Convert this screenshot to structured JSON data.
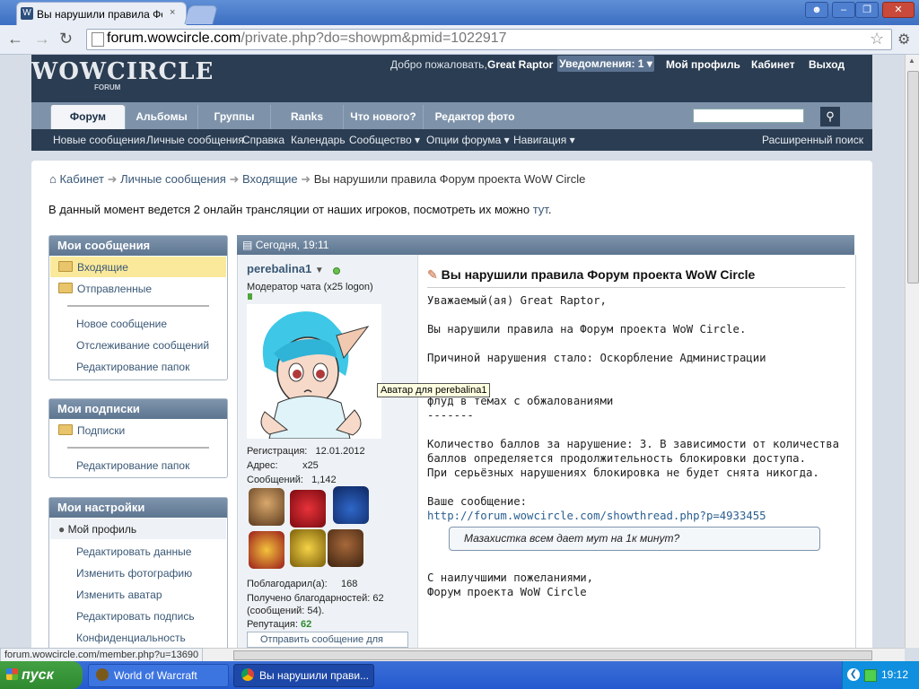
{
  "browser": {
    "tab_title": "Вы нарушили правила Фору",
    "tab_close": "×",
    "url_domain": "forum.wowcircle.com",
    "url_path": "/private.php?do=showpm&pmid=1022917",
    "status_url": "forum.wowcircle.com/member.php?u=13690"
  },
  "header": {
    "logo": "WOWCIRCLE",
    "logo_sub": "FORUM",
    "welcome": "Добро пожаловать,",
    "username": "Great Raptor",
    "notifications": "Уведомления: 1",
    "profile": "Мой профиль",
    "cabinet": "Кабинет",
    "exit": "Выход"
  },
  "nav": {
    "tabs": [
      "Форум",
      "Альбомы",
      "Группы",
      "Ranks",
      "Что нового?",
      "Редактор фото"
    ],
    "sublinks": [
      "Новые сообщения",
      "Личные сообщения",
      "Справка",
      "Календарь",
      "Сообщество",
      "Опции форума",
      "Навигация"
    ],
    "advanced_search": "Расширенный поиск"
  },
  "breadcrumbs": [
    "Кабинет",
    "Личные сообщения",
    "Входящие",
    "Вы нарушили правила Форум проекта WoW Circle"
  ],
  "notice": {
    "text": "В данный момент ведется 2 онлайн трансляции от наших игроков, посмотреть их можно ",
    "link": "тут",
    "end": "."
  },
  "sidebar": {
    "my_messages": {
      "title": "Мои сообщения",
      "inbox": "Входящие",
      "sent": "Отправленные",
      "links": [
        "Новое сообщение",
        "Отслеживание сообщений",
        "Редактирование папок"
      ]
    },
    "my_subscriptions": {
      "title": "Мои подписки",
      "subscriptions": "Подписки",
      "links": [
        "Редактирование папок"
      ]
    },
    "my_settings": {
      "title": "Мои настройки",
      "profile": "Мой профиль",
      "links": [
        "Редактировать данные",
        "Изменить фотографию",
        "Изменить аватар",
        "Редактировать подпись",
        "Конфиденциальность"
      ]
    }
  },
  "message": {
    "date": "Сегодня, 19:11",
    "sender": "perebalina1",
    "user_title": "Модератор чата (x25 logon)",
    "avatar_tooltip": "Аватар для perebalina1",
    "info": {
      "reg_label": "Регистрация:",
      "reg_value": "12.01.2012",
      "addr_label": "Адрес:",
      "addr_value": "x25",
      "posts_label": "Сообщений:",
      "posts_value": "1,142",
      "thanked_label": "Поблагодарил(а):",
      "thanked_value": "168",
      "thanks_label": "Получено благодарностей: 62",
      "thanks_label2": "(сообщений: 54).",
      "rep_label": "Репутация:",
      "rep_value": "62"
    },
    "send_message": "Отправить сообщение для",
    "title": "Вы нарушили правила Форум проекта WoW Circle",
    "lines": {
      "greeting": "Уважаемый(ая) Great Raptor,",
      "violated": "Вы нарушили правила на Форум проекта WoW Circle.",
      "reason": "Причиной нарушения стало: Оскорбление Администрации",
      "sep1": "-------",
      "detail": "флуд в темах с обжалованиями",
      "sep2": "-------",
      "points1": "Количество баллов за нарушение: 3. В зависимости от количества",
      "points2": "баллов определяется продолжительность блокировки доступа.",
      "points3": "При серьёзных нарушениях блокировка не будет снята никогда.",
      "your_msg": "Ваше сообщение:",
      "link": "http://forum.wowcircle.com/showthread.php?p=4933455",
      "quote": "Мазахистка всем дает мут на 1к минут?",
      "regards": "С наилучшими пожеланиями,",
      "signature": "Форум проекта WoW Circle"
    }
  },
  "taskbar": {
    "start": "пуск",
    "item1": "World of Warcraft",
    "item2": "Вы нарушили прави...",
    "clock": "19:12"
  },
  "colors": {
    "header_bg": "#2b3d52",
    "nav_bg": "#7e93aa",
    "link": "#3a5876",
    "reputation": "#2e8b2e"
  }
}
